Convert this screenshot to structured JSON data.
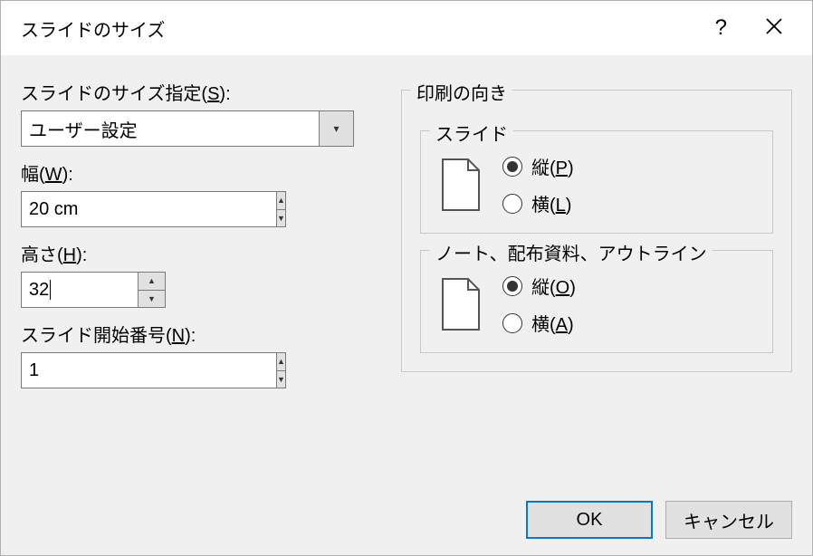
{
  "titlebar": {
    "title": "スライドのサイズ",
    "help": "?",
    "close": "×"
  },
  "left": {
    "size_label_pre": "スライドのサイズ指定(",
    "size_label_mn": "S",
    "size_label_post": "):",
    "size_value": "ユーザー設定",
    "width_label_pre": "幅(",
    "width_label_mn": "W",
    "width_label_post": "):",
    "width_value": "20 cm",
    "height_label_pre": "高さ(",
    "height_label_mn": "H",
    "height_label_post": "):",
    "height_value": "32",
    "startnum_label_pre": "スライド開始番号(",
    "startnum_label_mn": "N",
    "startnum_label_post": "):",
    "startnum_value": "1"
  },
  "right": {
    "outer_title": "印刷の向き",
    "slide_group_title": "スライド",
    "slide_portrait_pre": "縦(",
    "slide_portrait_mn": "P",
    "slide_portrait_post": ")",
    "slide_landscape_pre": "横(",
    "slide_landscape_mn": "L",
    "slide_landscape_post": ")",
    "notes_group_title": "ノート、配布資料、アウトライン",
    "notes_portrait_pre": "縦(",
    "notes_portrait_mn": "O",
    "notes_portrait_post": ")",
    "notes_landscape_pre": "横(",
    "notes_landscape_mn": "A",
    "notes_landscape_post": ")"
  },
  "buttons": {
    "ok": "OK",
    "cancel": "キャンセル"
  }
}
